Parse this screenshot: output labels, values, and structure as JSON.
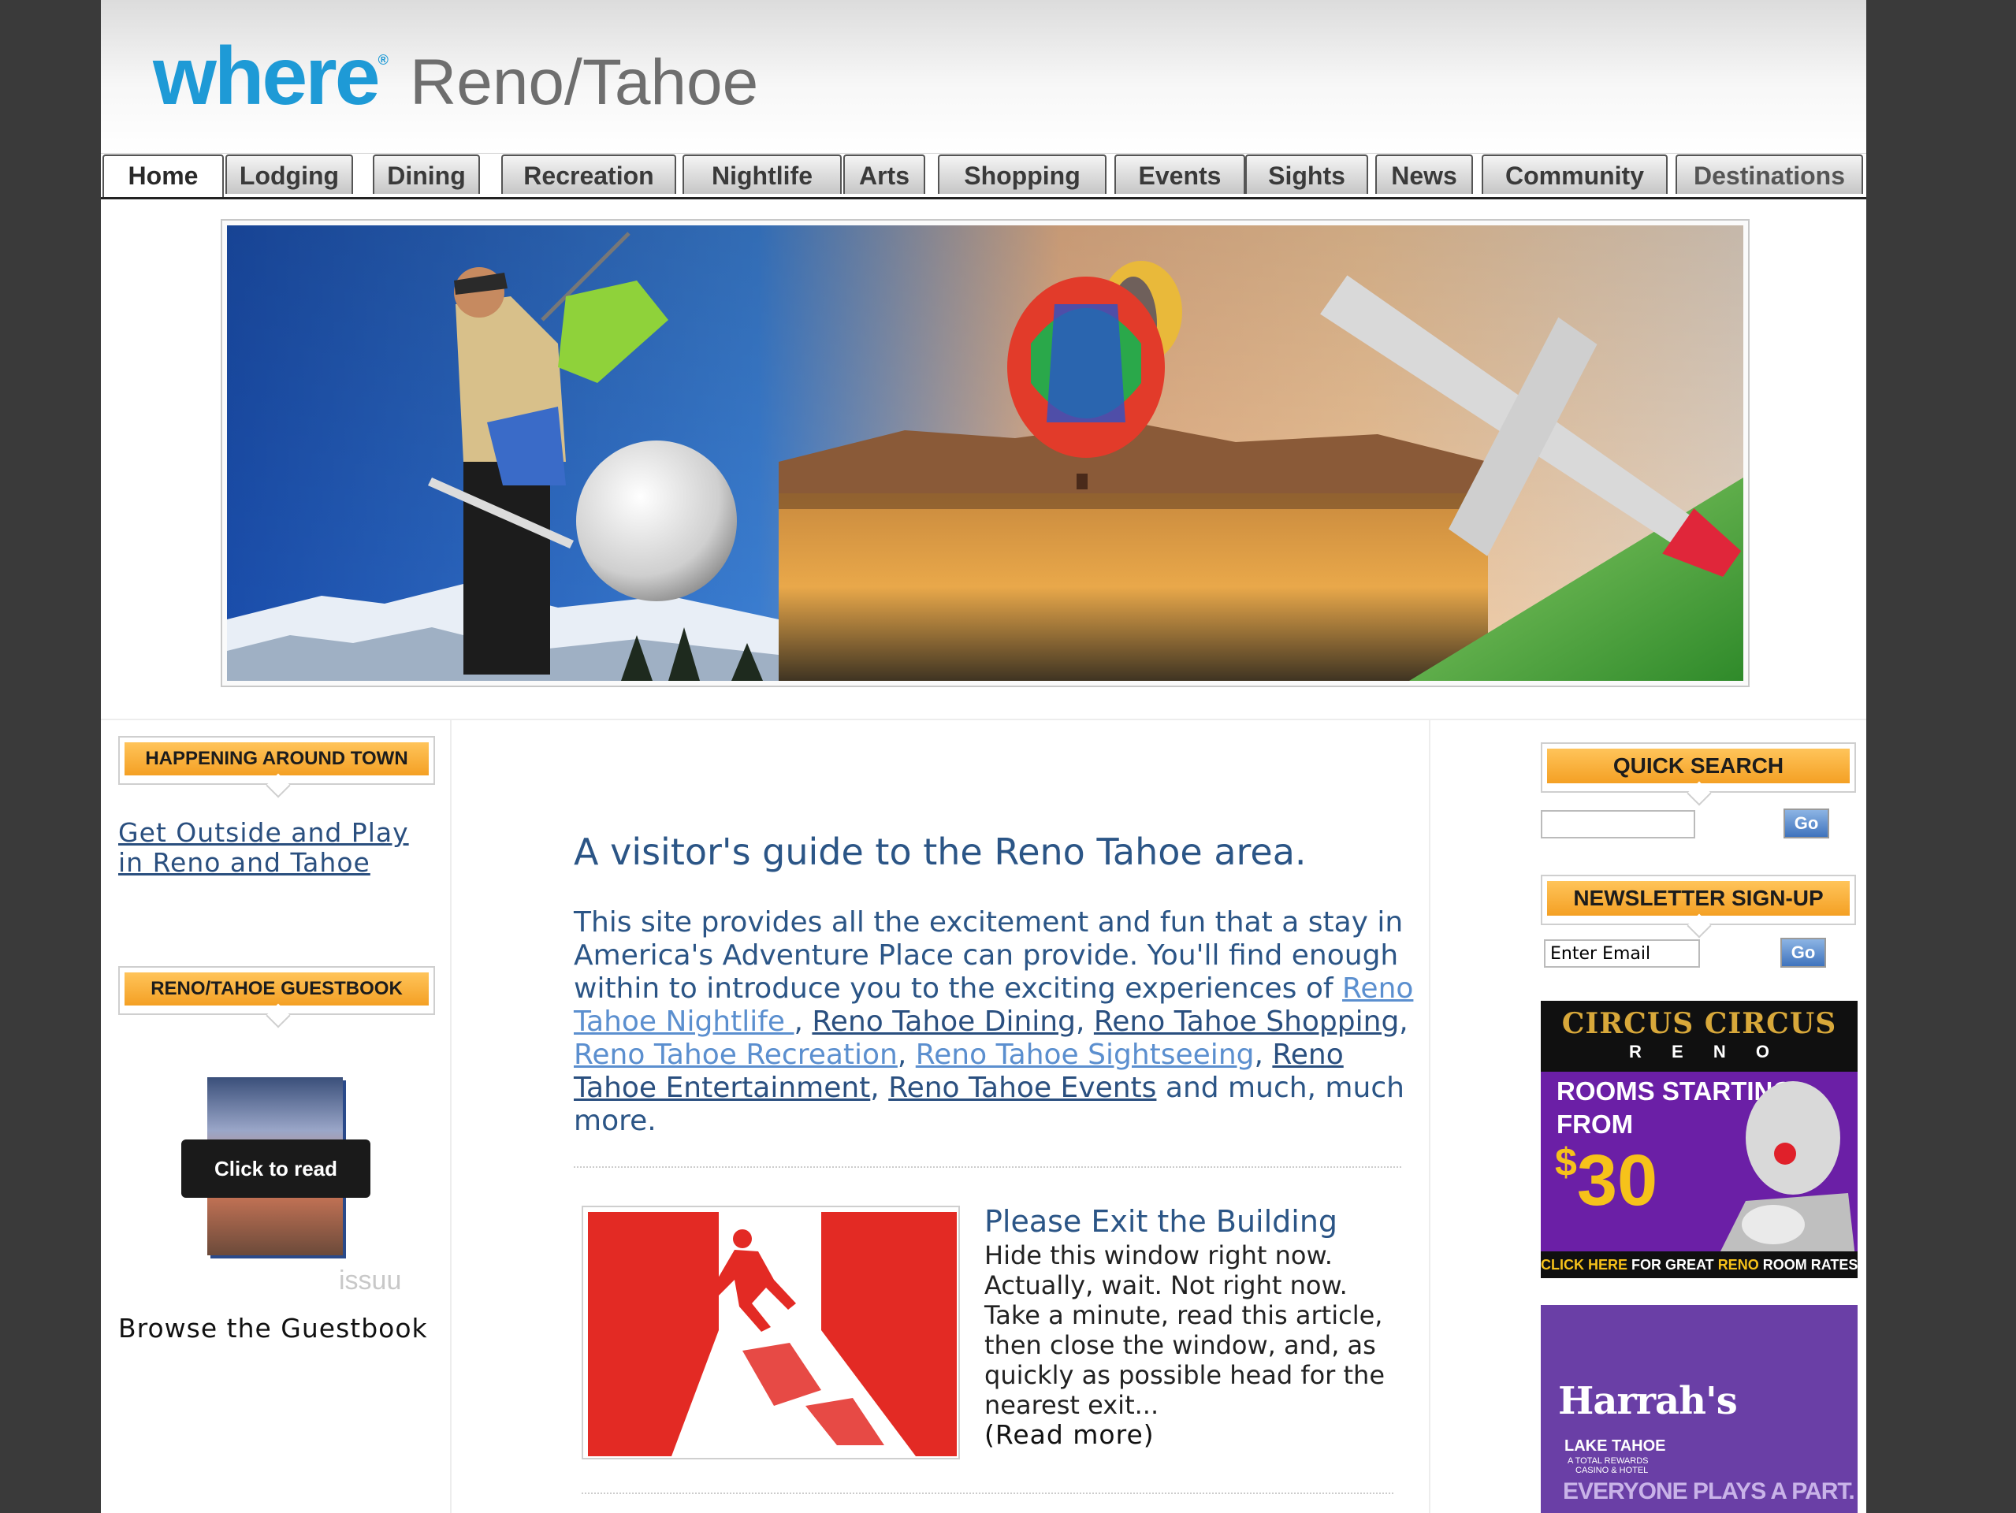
{
  "header": {
    "logo_where": "where",
    "logo_reg": "®",
    "logo_city": "Reno/Tahoe"
  },
  "nav": {
    "tabs": [
      "Home",
      "Lodging",
      "Dining",
      "Recreation",
      "Nightlife",
      "Arts",
      "Shopping",
      "Events",
      "Sights",
      "News",
      "Community",
      "Destinations"
    ],
    "active": "Home"
  },
  "left": {
    "happening_title": "HAPPENING AROUND TOWN",
    "happening_link": "Get Outside and Play in Reno and Tahoe",
    "guestbook_title": "RENO/TAHOE GUESTBOOK",
    "click_to_read": "Click to read",
    "issuu": "issuu",
    "browse_label": "Browse the Guestbook"
  },
  "main": {
    "heading": "A visitor's guide to the Reno Tahoe area.",
    "intro_prefix": "This site provides all the excitement and fun that a stay in America's Adventure Place can provide. You'll find enough within to introduce you to the exciting experiences of ",
    "links": {
      "nightlife": "Reno Tahoe Nightlife ",
      "dining": "Reno Tahoe Dining",
      "shopping": "Reno Tahoe Shopping",
      "recreation": "Reno Tahoe Recreation",
      "sightseeing": "Reno Tahoe Sightseeing",
      "entertainment": "Reno Tahoe Entertainment",
      "events": "Reno Tahoe Events"
    },
    "intro_suffix": " and much, much more.",
    "article": {
      "title": "Please Exit the Building",
      "body": "Hide this window right now. Actually, wait. Not right now. Take a minute, read this article, then close the window, and, as quickly as possible head for the nearest exit...",
      "read_more": "(Read more)"
    }
  },
  "right": {
    "quick_search_title": "QUICK SEARCH",
    "search_value": "",
    "go_label": "Go",
    "newsletter_title": "NEWSLETTER SIGN-UP",
    "email_value": "Enter Email",
    "ad1": {
      "brand": "CIRCUS CIRCUS",
      "sub": "R E N O",
      "line1": "ROOMS STARTING",
      "line2": "FROM",
      "dollar": "$",
      "price": "30",
      "cta_a": "CLICK HERE",
      "cta_b": " FOR GREAT ",
      "cta_c": "RENO",
      "cta_d": " ROOM RATES"
    },
    "ad2": {
      "brand": "Harrah's",
      "sub": "LAKE TAHOE",
      "sub2": "A TOTAL REWARDS",
      "sub3": "CASINO & HOTEL",
      "tagline": "EVERYONE PLAYS A PART."
    }
  },
  "colors": {
    "accent": "#1e9ad6",
    "heading": "#2b5586",
    "box": "#f4a024",
    "ad_purple": "#6a3fa6"
  }
}
